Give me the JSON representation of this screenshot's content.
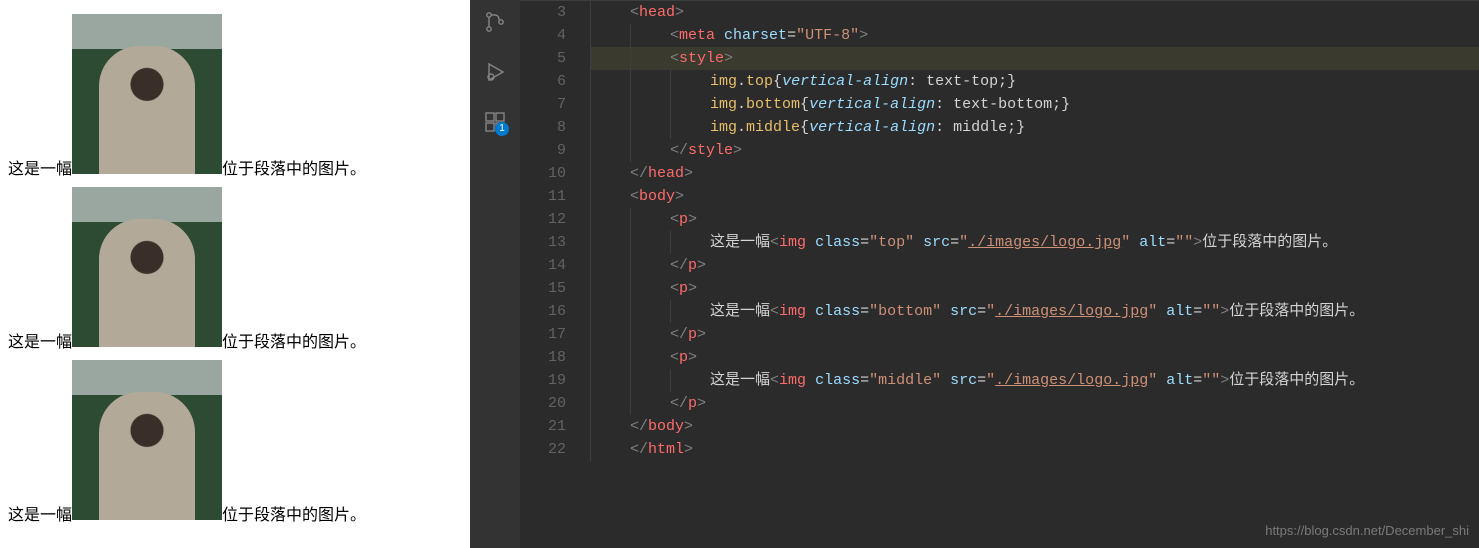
{
  "preview": {
    "before": "这是一幅",
    "after": "位于段落中的图片。"
  },
  "activitybar": {
    "badge": "1"
  },
  "code": {
    "lines": [
      {
        "n": 3,
        "indent": 1,
        "html": "<span class='brkt'>&lt;</span><span class='close'>head</span><span class='brkt'>&gt;</span>"
      },
      {
        "n": 4,
        "indent": 2,
        "html": "<span class='brkt'>&lt;</span><span class='close'>meta</span> <span class='attr'>charset</span><span class='txt'>=</span><span class='str'>\"UTF-8\"</span><span class='brkt'>&gt;</span>"
      },
      {
        "n": 5,
        "indent": 2,
        "hl": true,
        "html": "<span class='brkt'>&lt;</span><span class='close'>style</span><span class='brkt'>&gt;</span>"
      },
      {
        "n": 6,
        "indent": 3,
        "html": "<span class='tag'>img</span><span class='txt'>.</span><span class='tag'>top</span><span class='txt'>{</span><span class='ital'>vertical-align</span><span class='txt'>: text-top;}</span>"
      },
      {
        "n": 7,
        "indent": 3,
        "html": "<span class='tag'>img</span><span class='txt'>.</span><span class='tag'>bottom</span><span class='txt'>{</span><span class='ital'>vertical-align</span><span class='txt'>: text-bottom;}</span>"
      },
      {
        "n": 8,
        "indent": 3,
        "html": "<span class='tag'>img</span><span class='txt'>.</span><span class='tag'>middle</span><span class='txt'>{</span><span class='ital'>vertical-align</span><span class='txt'>: middle;}</span>"
      },
      {
        "n": 9,
        "indent": 2,
        "html": "<span class='brkt'>&lt;/</span><span class='close'>style</span><span class='brkt'>&gt;</span>"
      },
      {
        "n": 10,
        "indent": 1,
        "html": "<span class='brkt'>&lt;/</span><span class='close'>head</span><span class='brkt'>&gt;</span>"
      },
      {
        "n": 11,
        "indent": 1,
        "html": "<span class='brkt'>&lt;</span><span class='close'>body</span><span class='brkt'>&gt;</span>"
      },
      {
        "n": 12,
        "indent": 2,
        "html": "<span class='brkt'>&lt;</span><span class='close'>p</span><span class='brkt'>&gt;</span>"
      },
      {
        "n": 13,
        "indent": 3,
        "html": "<span class='txt'>这是一幅</span><span class='brkt'>&lt;</span><span class='close'>img</span> <span class='attr'>class</span><span class='txt'>=</span><span class='str'>\"top\"</span> <span class='attr'>src</span><span class='txt'>=</span><span class='str'>\"</span><span class='url'>./images/logo.jpg</span><span class='str'>\"</span> <span class='attr'>alt</span><span class='txt'>=</span><span class='str'>\"\"</span><span class='brkt'>&gt;</span><span class='txt'>位于段落中的图片。</span>"
      },
      {
        "n": 14,
        "indent": 2,
        "html": "<span class='brkt'>&lt;/</span><span class='close'>p</span><span class='brkt'>&gt;</span>"
      },
      {
        "n": 15,
        "indent": 2,
        "html": "<span class='brkt'>&lt;</span><span class='close'>p</span><span class='brkt'>&gt;</span>"
      },
      {
        "n": 16,
        "indent": 3,
        "html": "<span class='txt'>这是一幅</span><span class='brkt'>&lt;</span><span class='close'>img</span> <span class='attr'>class</span><span class='txt'>=</span><span class='str'>\"bottom\"</span> <span class='attr'>src</span><span class='txt'>=</span><span class='str'>\"</span><span class='url'>./images/logo.jpg</span><span class='str'>\"</span> <span class='attr'>alt</span><span class='txt'>=</span><span class='str'>\"\"</span><span class='brkt'>&gt;</span><span class='txt'>位于段落中的图片。</span>"
      },
      {
        "n": 17,
        "indent": 2,
        "html": "<span class='brkt'>&lt;/</span><span class='close'>p</span><span class='brkt'>&gt;</span>"
      },
      {
        "n": 18,
        "indent": 2,
        "html": "<span class='brkt'>&lt;</span><span class='close'>p</span><span class='brkt'>&gt;</span>"
      },
      {
        "n": 19,
        "indent": 3,
        "html": "<span class='txt'>这是一幅</span><span class='brkt'>&lt;</span><span class='close'>img</span> <span class='attr'>class</span><span class='txt'>=</span><span class='str'>\"middle\"</span> <span class='attr'>src</span><span class='txt'>=</span><span class='str'>\"</span><span class='url'>./images/logo.jpg</span><span class='str'>\"</span> <span class='attr'>alt</span><span class='txt'>=</span><span class='str'>\"\"</span><span class='brkt'>&gt;</span><span class='txt'>位于段落中的图片。</span>"
      },
      {
        "n": 20,
        "indent": 2,
        "html": "<span class='brkt'>&lt;/</span><span class='close'>p</span><span class='brkt'>&gt;</span>"
      },
      {
        "n": 21,
        "indent": 1,
        "html": "<span class='brkt'>&lt;/</span><span class='close'>body</span><span class='brkt'>&gt;</span>"
      },
      {
        "n": 22,
        "indent": 1,
        "html": "<span class='brkt'>&lt;/</span><span class='close'>html</span><span class='brkt'>&gt;</span>"
      }
    ]
  },
  "watermark": "https://blog.csdn.net/December_shi"
}
